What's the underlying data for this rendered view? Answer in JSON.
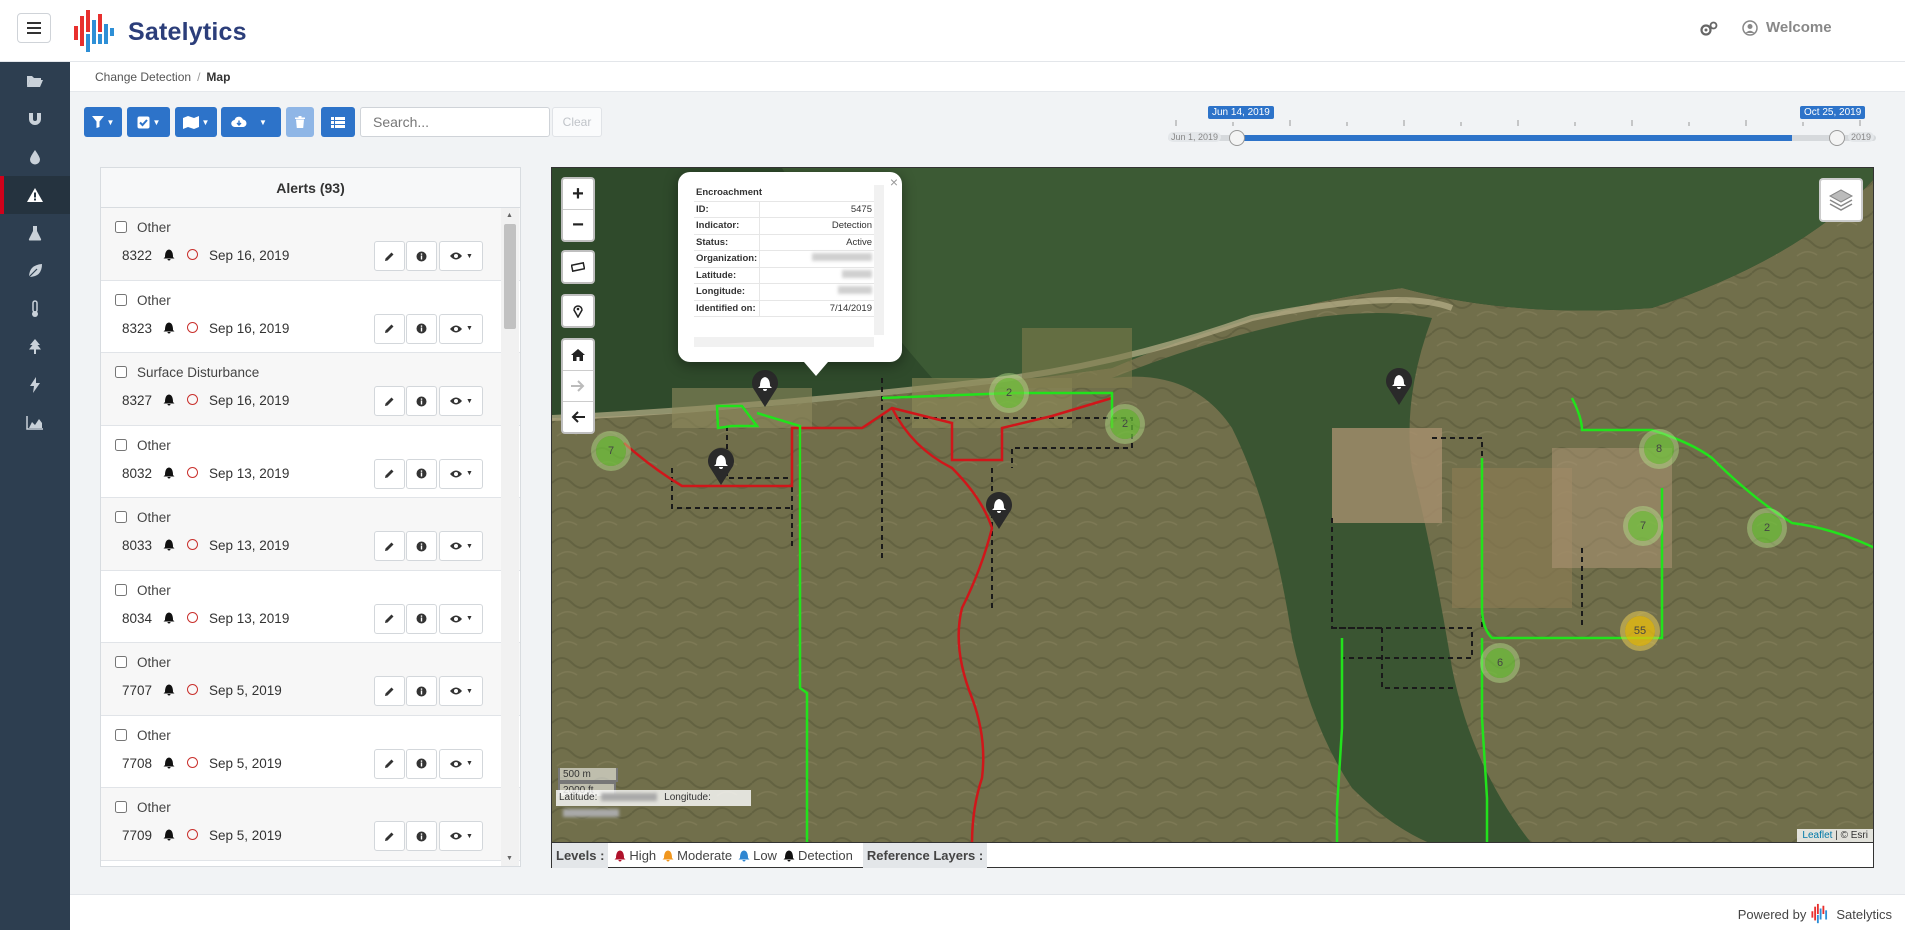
{
  "header": {
    "logo_text": "Satelytics",
    "user_label": "Welcome"
  },
  "sidebar": {
    "icons": [
      "folder-open-icon",
      "magnet-icon",
      "water-drop-icon",
      "warning-icon",
      "flask-icon",
      "leaf-icon",
      "thermometer-icon",
      "tree-icon",
      "bolt-icon",
      "area-chart-icon"
    ],
    "active_index": 3
  },
  "breadcrumb": {
    "parent": "Change Detection",
    "separator": "/",
    "current": "Map"
  },
  "toolbar": {
    "search_placeholder": "Search...",
    "clear_label": "Clear"
  },
  "timeline": {
    "start_label": "Jun 14, 2019",
    "end_label": "Oct 25, 2019",
    "min_label": "Jun 1, 2019",
    "max_label": "2019"
  },
  "alerts": {
    "title": "Alerts (93)",
    "items": [
      {
        "type": "Other",
        "id": "8322",
        "date": "Sep 16, 2019"
      },
      {
        "type": "Other",
        "id": "8323",
        "date": "Sep 16, 2019"
      },
      {
        "type": "Surface Disturbance",
        "id": "8327",
        "date": "Sep 16, 2019"
      },
      {
        "type": "Other",
        "id": "8032",
        "date": "Sep 13, 2019"
      },
      {
        "type": "Other",
        "id": "8033",
        "date": "Sep 13, 2019"
      },
      {
        "type": "Other",
        "id": "8034",
        "date": "Sep 13, 2019"
      },
      {
        "type": "Other",
        "id": "7707",
        "date": "Sep 5, 2019"
      },
      {
        "type": "Other",
        "id": "7708",
        "date": "Sep 5, 2019"
      },
      {
        "type": "Other",
        "id": "7709",
        "date": "Sep 5, 2019"
      },
      {
        "type": "",
        "id": "",
        "date": ""
      }
    ]
  },
  "popup": {
    "title": "Encroachment",
    "rows": [
      {
        "label": "ID:",
        "value": "5475"
      },
      {
        "label": "Indicator:",
        "value": "Detection"
      },
      {
        "label": "Status:",
        "value": "Active"
      },
      {
        "label": "Organization:",
        "value": ""
      },
      {
        "label": "Latitude:",
        "value": ""
      },
      {
        "label": "Longitude:",
        "value": ""
      },
      {
        "label": "Identified on:",
        "value": "7/14/2019"
      }
    ],
    "close": "×"
  },
  "map": {
    "scale_metric": "500 m",
    "scale_imperial": "2000 ft",
    "lat_label": "Latitude:",
    "lon_label": "Longitude:",
    "attribution_leaflet": "Leaflet",
    "attribution_sep": " | © ",
    "attribution_esri": "Esri",
    "clusters": [
      {
        "label": "7"
      },
      {
        "label": "2"
      },
      {
        "label": "2"
      },
      {
        "label": "8"
      },
      {
        "label": "7"
      },
      {
        "label": "2"
      },
      {
        "label": "55"
      },
      {
        "label": "6"
      }
    ]
  },
  "legend": {
    "levels_label": "Levels :",
    "high": "High",
    "moderate": "Moderate",
    "low": "Low",
    "detection": "Detection",
    "reference_label": "Reference Layers :",
    "colors": {
      "high": "#b0122b",
      "moderate": "#f0961e",
      "low": "#2f86d1",
      "detection": "#111111"
    }
  },
  "footer": {
    "powered_by": "Powered by",
    "brand": "Satelytics"
  }
}
